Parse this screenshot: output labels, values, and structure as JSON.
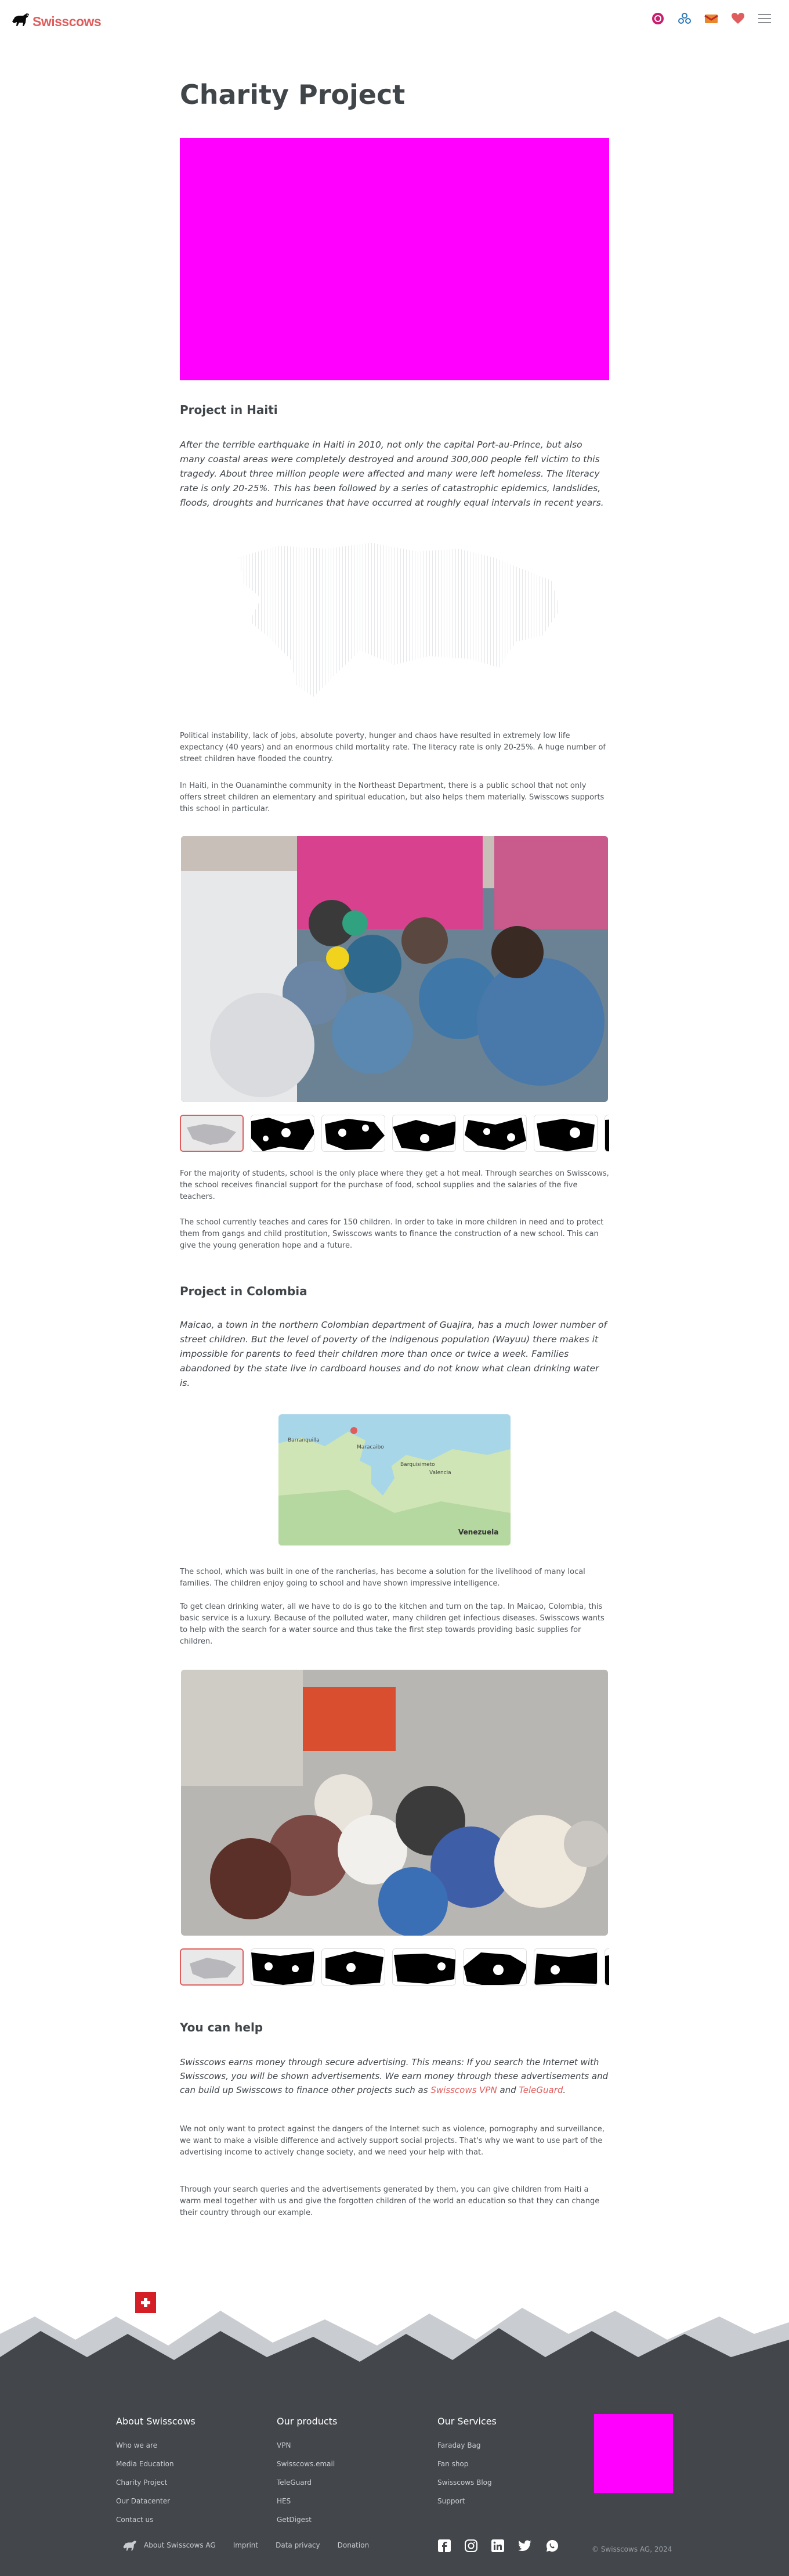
{
  "header": {
    "brand": "Swisscows",
    "icons": [
      "teleguard-icon",
      "vpn-icon",
      "email-icon",
      "heart-icon",
      "menu-icon"
    ]
  },
  "page_title": "Charity Project",
  "haiti": {
    "heading": "Project in Haiti",
    "lead": "After the terrible earthquake in Haiti in 2010, not only the capital Port-au-Prince, but also many coastal areas were completely destroyed and around 300,000 people fell victim to this tragedy. About three million people were affected and many were left homeless. The literacy rate is only 20-25%. This has been followed by a series of catastrophic epidemics, landslides, floods, droughts and hurricanes that have occurred at roughly equal intervals in recent years.",
    "p1": "Political instability, lack of jobs, absolute poverty, hunger and chaos have resulted in extremely low life expectancy (40 years) and an enormous child mortality rate. The literacy rate is only 20-25%. A huge number of street children have flooded the country.",
    "p2": "In Haiti, in the Ouanaminthe community in the Northeast Department, there is a public school that not only offers street children an elementary and spiritual education, but also helps them materially. Swisscows supports this school in particular.",
    "p3": "For the majority of students, school is the only place where they get a hot meal. Through searches on Swisscows, the school receives financial support for the purchase of food, school supplies and the salaries of the five teachers.",
    "p4": "The school currently teaches and cares for 150 children. In order to take in more children in need and to protect them from gangs and child prostitution, Swisscows wants to finance the construction of a new school. This can give the young generation hope and a future."
  },
  "colombia": {
    "heading": "Project in Colombia",
    "lead": "Maicao, a town in the northern Colombian department of Guajira, has a much lower number of street children. But the level of poverty of the indigenous population (Wayuu) there makes it impossible for parents to feed their children more than once or twice a week. Families abandoned by the state live in cardboard houses and do not know what clean drinking water is.",
    "map_labels": [
      "Barranquilla",
      "Maracaibo",
      "Barquisimeto",
      "Valencia",
      "Venezuela"
    ],
    "p1": "The school, which was built in one of the rancherias, has become a solution for the livelihood of many local families. The children enjoy going to school and have shown impressive intelligence.",
    "p2": "To get clean drinking water, all we have to do is go to the kitchen and turn on the tap. In Maicao, Colombia, this basic service is a luxury. Because of the polluted water, many children get infectious diseases. Swisscows wants to help with the search for a water source and thus take the first step towards providing basic supplies for children."
  },
  "help": {
    "heading": "You can help",
    "lead_start": "Swisscows earns money through secure advertising. This means: If you search the Internet with Swisscows, you will be shown advertisements. We earn money through these advertisements and can build up Swisscows to finance other projects such as ",
    "link_vpn": "Swisscows VPN",
    "lead_and": " and ",
    "link_teleguard": "TeleGuard",
    "lead_end": ".",
    "p1": "We not only want to protect against the dangers of the Internet such as violence, pornography and surveillance, we want to make a visible difference and actively support social projects. That's why we want to use part of the advertising income to actively change society, and we need your help with that.",
    "p2": "Through your search queries and the advertisements generated by them, you can give children from Haiti a warm meal together with us and give the forgotten children of the world an education so that they can change their country through our example."
  },
  "footer": {
    "col1": {
      "title": "About Swisscows",
      "items": [
        "Who we are",
        "Media Education",
        "Charity Project",
        "Our Datacenter",
        "Contact us"
      ]
    },
    "col2": {
      "title": "Our products",
      "items": [
        "VPN",
        "Swisscows.email",
        "TeleGuard",
        "HES",
        "GetDigest"
      ]
    },
    "col3": {
      "title": "Our Services",
      "items": [
        "Faraday Bag",
        "Fan shop",
        "Swisscows Blog",
        "Support"
      ]
    },
    "bottom_links": [
      "About Swisscows AG",
      "Imprint",
      "Data privacy",
      "Donation"
    ],
    "social": [
      "facebook-icon",
      "instagram-icon",
      "linkedin-icon",
      "twitter-icon",
      "whatsapp-icon"
    ],
    "copyright": "© Swisscows AG, 2024"
  },
  "colors": {
    "accent": "#df5d5d",
    "footer_bg": "#43474c",
    "placeholder": "#ff00ff"
  }
}
